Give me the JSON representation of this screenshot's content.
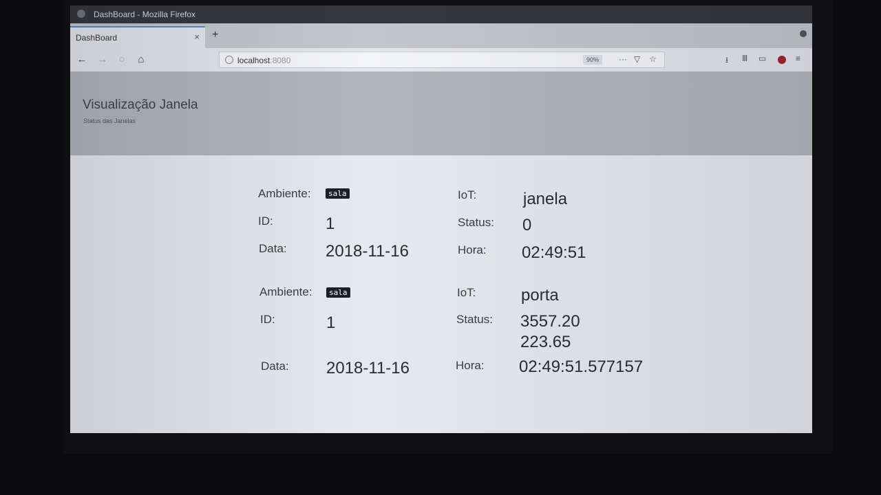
{
  "window": {
    "title": "DashBoard - Mozilla Firefox"
  },
  "tab": {
    "label": "DashBoard",
    "close": "×",
    "new_tab": "+"
  },
  "nav": {
    "back": "←",
    "forward": "→",
    "reload": "○",
    "home": "⌂"
  },
  "url": {
    "host": "localhost",
    "port": ":8080",
    "zoom": "90%",
    "more": "···",
    "pocket": "▽",
    "star": "☆"
  },
  "toolbar": {
    "downloads": "⭳",
    "library": "Ⅲ",
    "sidebar": "▭",
    "menu": "≡"
  },
  "page": {
    "title": "Visualização Janela",
    "subtitle": "Status das Janelas"
  },
  "records": [
    {
      "ambiente_label": "Ambiente:",
      "ambiente": "sala",
      "iot_label": "IoT:",
      "iot": "janela",
      "id_label": "ID:",
      "id": "1",
      "status_label": "Status:",
      "status": "0",
      "status2": "",
      "data_label": "Data:",
      "data": "2018-11-16",
      "hora_label": "Hora:",
      "hora": "02:49:51"
    },
    {
      "ambiente_label": "Ambiente:",
      "ambiente": "sala",
      "iot_label": "IoT:",
      "iot": "porta",
      "id_label": "ID:",
      "id": "1",
      "status_label": "Status:",
      "status": "3557.20",
      "status2": "223.65",
      "data_label": "Data:",
      "data": "2018-11-16",
      "hora_label": "Hora:",
      "hora": "02:49:51.577157"
    }
  ]
}
